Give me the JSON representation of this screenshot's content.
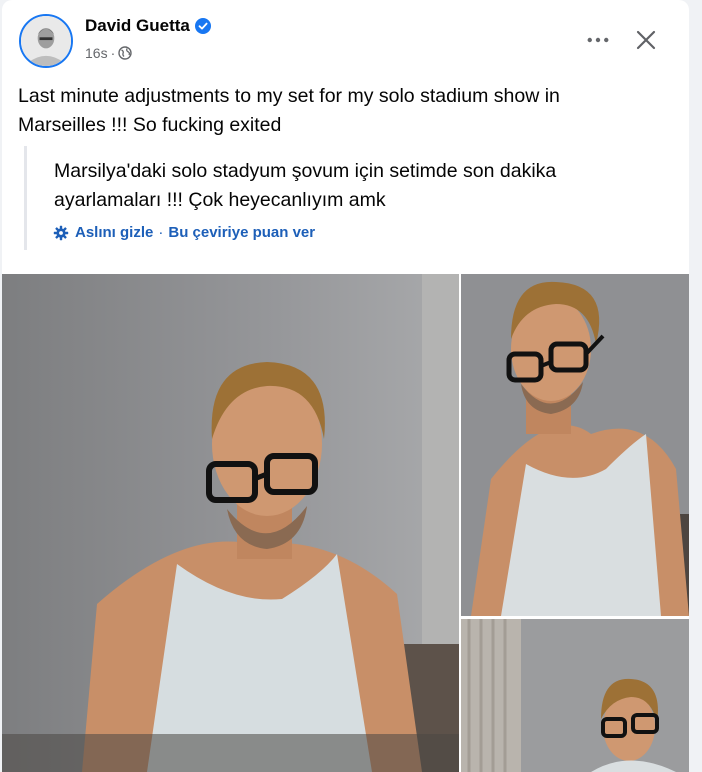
{
  "post": {
    "author": "David Guetta",
    "time": "16s",
    "text_line1": "Last minute adjustments to my set for my solo stadium show in",
    "text_line2": "Marseilles !!! So fucking exited"
  },
  "translation": {
    "line1": "Marsilya'daki solo stadyum şovum için setimde son dakika",
    "line2": "ayarlamaları !!! Çok heyecanlıyım amk",
    "hide_original": "Aslını gizle",
    "separator": "·",
    "rate_translation": "Bu çeviriye puan ver"
  },
  "meta": {
    "separator": "·"
  },
  "icons": {
    "verified": "verified-badge-icon",
    "audience": "globe-icon",
    "more": "more-options-icon",
    "close": "close-icon",
    "translation": "gear-icon"
  },
  "colors": {
    "brand_blue": "#1877f2",
    "link_blue": "#1d5fb8",
    "secondary_text": "#65676b"
  }
}
